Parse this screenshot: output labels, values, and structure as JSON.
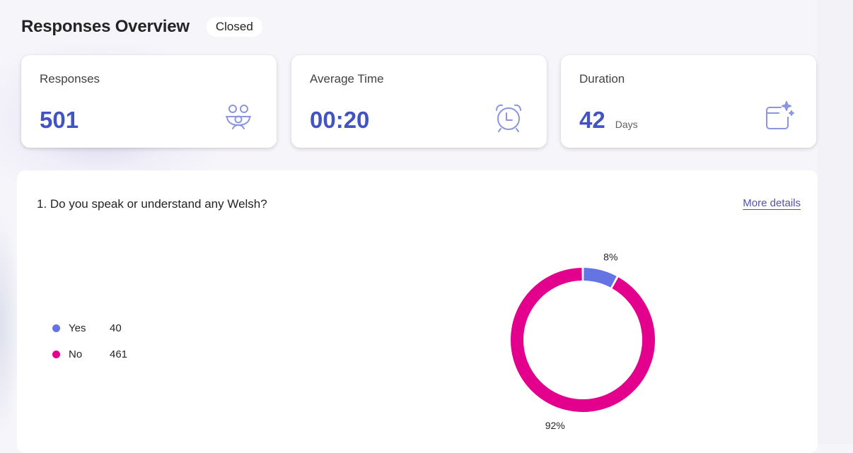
{
  "header": {
    "title": "Responses Overview",
    "status": "Closed"
  },
  "cards": [
    {
      "label": "Responses",
      "value": "501",
      "unit": "",
      "icon": "people-group-icon"
    },
    {
      "label": "Average Time",
      "value": "00:20",
      "unit": "",
      "icon": "alarm-clock-icon"
    },
    {
      "label": "Duration",
      "value": "42",
      "unit": "Days",
      "icon": "calendar-sparkle-icon"
    }
  ],
  "colors": {
    "accent": "#4253c2",
    "yes": "#6474e5",
    "no": "#e3008c"
  },
  "question": {
    "title": "1. Do you speak or understand any Welsh?",
    "more_details": "More details"
  },
  "chart_data": {
    "type": "pie",
    "style": "donut",
    "categories": [
      "Yes",
      "No"
    ],
    "values": [
      40,
      461
    ],
    "colors": [
      "#6474e5",
      "#e3008c"
    ],
    "slice_labels": [
      "8%",
      "92%"
    ],
    "legend": [
      {
        "label": "Yes",
        "count": "40"
      },
      {
        "label": "No",
        "count": "461"
      }
    ],
    "legend_position": "left"
  }
}
